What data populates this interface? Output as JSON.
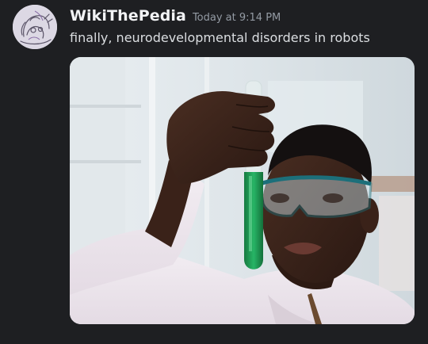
{
  "message": {
    "author": "WikiThePedia",
    "timestamp": "Today at 9:14 PM",
    "content": "finally, neurodevelopmental disorders in robots"
  },
  "attachment": {
    "kind": "image",
    "depicts": "scientist-with-green-test-tube"
  },
  "colors": {
    "background": "#1e1f22",
    "username": "#f2f3f5",
    "timestamp": "#949ba4",
    "content": "#dbdee1",
    "liquid": "#1f9e55"
  }
}
